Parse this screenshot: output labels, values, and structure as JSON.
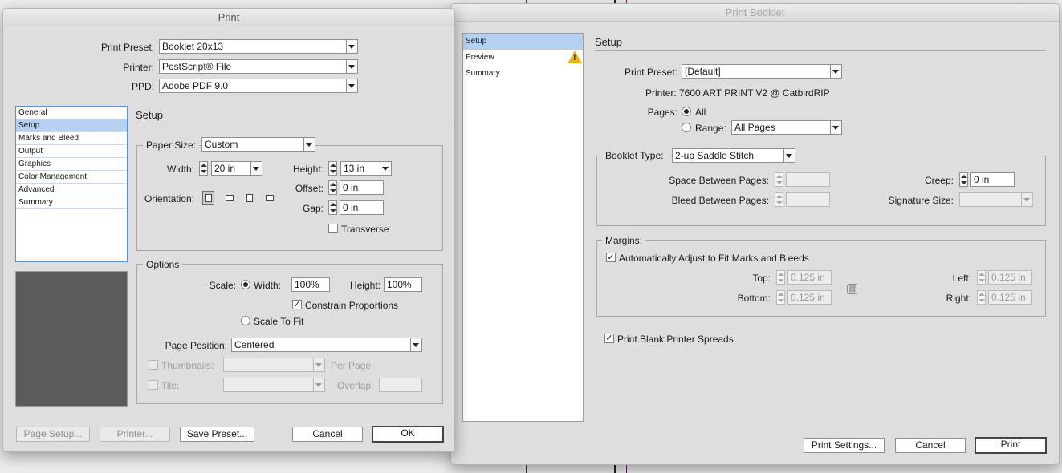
{
  "print": {
    "title": "Print",
    "preset_label": "Print Preset:",
    "preset_value": "Booklet 20x13",
    "printer_label": "Printer:",
    "printer_value": "PostScript® File",
    "ppd_label": "PPD:",
    "ppd_value": "Adobe PDF 9.0",
    "nav": [
      "General",
      "Setup",
      "Marks and Bleed",
      "Output",
      "Graphics",
      "Color Management",
      "Advanced",
      "Summary"
    ],
    "section_title": "Setup",
    "paper_size_label": "Paper Size:",
    "paper_size_value": "Custom",
    "width_label": "Width:",
    "width_value": "20 in",
    "height_label": "Height:",
    "height_value": "13 in",
    "orientation_label": "Orientation:",
    "offset_label": "Offset:",
    "offset_value": "0 in",
    "gap_label": "Gap:",
    "gap_value": "0 in",
    "transverse_label": "Transverse",
    "options_title": "Options",
    "scale_label": "Scale:",
    "scale_width_label": "Width:",
    "scale_width_value": "100%",
    "scale_height_label": "Height:",
    "scale_height_value": "100%",
    "constrain_label": "Constrain Proportions",
    "scale_to_fit_label": "Scale To Fit",
    "page_position_label": "Page Position:",
    "page_position_value": "Centered",
    "thumbnails_label": "Thumbnails:",
    "per_page_label": "Per Page",
    "tile_label": "Tile:",
    "overlap_label": "Overlap:",
    "buttons": {
      "page_setup": "Page Setup...",
      "printer": "Printer...",
      "save_preset": "Save Preset...",
      "cancel": "Cancel",
      "ok": "OK"
    }
  },
  "booklet": {
    "title": "Print Booklet",
    "nav": [
      "Setup",
      "Preview",
      "Summary"
    ],
    "section_title": "Setup",
    "preset_label": "Print Preset:",
    "preset_value": "[Default]",
    "printer_text": "Printer: 7600 ART PRINT V2 @ CatbirdRIP",
    "pages_label": "Pages:",
    "all_label": "All",
    "range_label": "Range:",
    "range_value": "All Pages",
    "booklet_type_label": "Booklet Type:",
    "booklet_type_value": "2-up Saddle Stitch",
    "space_between_label": "Space Between Pages:",
    "bleed_between_label": "Bleed Between Pages:",
    "creep_label": "Creep:",
    "creep_value": "0 in",
    "signature_label": "Signature Size:",
    "margins_title": "Margins:",
    "auto_adjust_label": "Automatically Adjust to Fit Marks and Bleeds",
    "top_label": "Top:",
    "top_value": "0.125 in",
    "bottom_label": "Bottom:",
    "bottom_value": "0.125 in",
    "left_label": "Left:",
    "left_value": "0.125 in",
    "right_label": "Right:",
    "right_value": "0.125 in",
    "blank_spreads_label": "Print Blank Printer Spreads",
    "buttons": {
      "print_settings": "Print Settings...",
      "cancel": "Cancel",
      "print": "Print"
    }
  },
  "icons": {
    "warning": "warning-icon",
    "link": "link-margins-icon",
    "orientations": [
      "portrait",
      "landscape",
      "reverse-portrait",
      "reverse-landscape"
    ]
  }
}
